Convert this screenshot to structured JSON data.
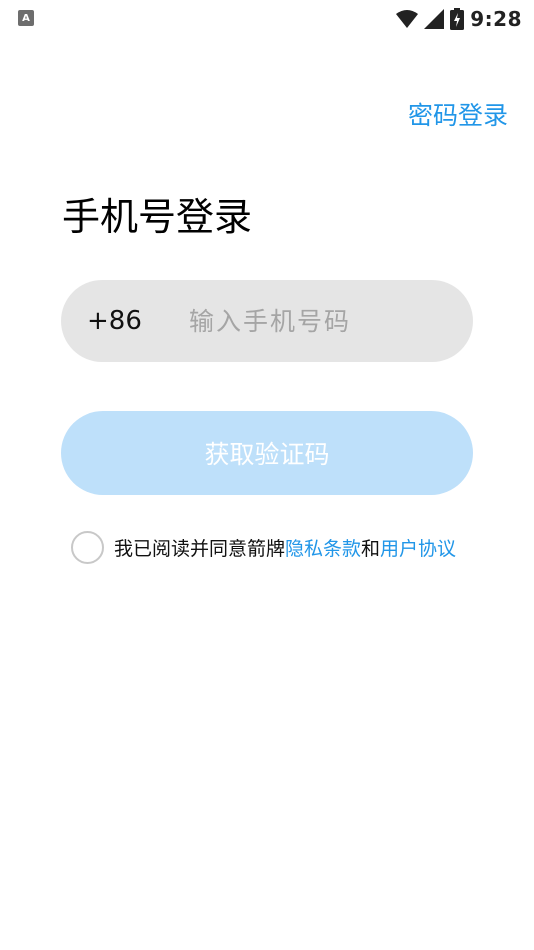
{
  "status_bar": {
    "app_icon_letter": "A",
    "time": "9:28",
    "icons": [
      "wifi-icon",
      "signal-icon",
      "battery-charging-icon"
    ]
  },
  "header": {
    "password_login_label": "密码登录"
  },
  "main": {
    "title": "手机号登录",
    "country_code": "+86",
    "phone_placeholder": "输入手机号码",
    "phone_value": "",
    "get_code_label": "获取验证码"
  },
  "agreement": {
    "prefix": "我已阅读并同意箭牌",
    "privacy_link": "隐私条款",
    "and": "和",
    "user_link": "用户协议",
    "checked": false
  },
  "colors": {
    "accent": "#2196e8",
    "button_disabled": "#bee0fa",
    "input_bg": "#e5e5e5"
  }
}
